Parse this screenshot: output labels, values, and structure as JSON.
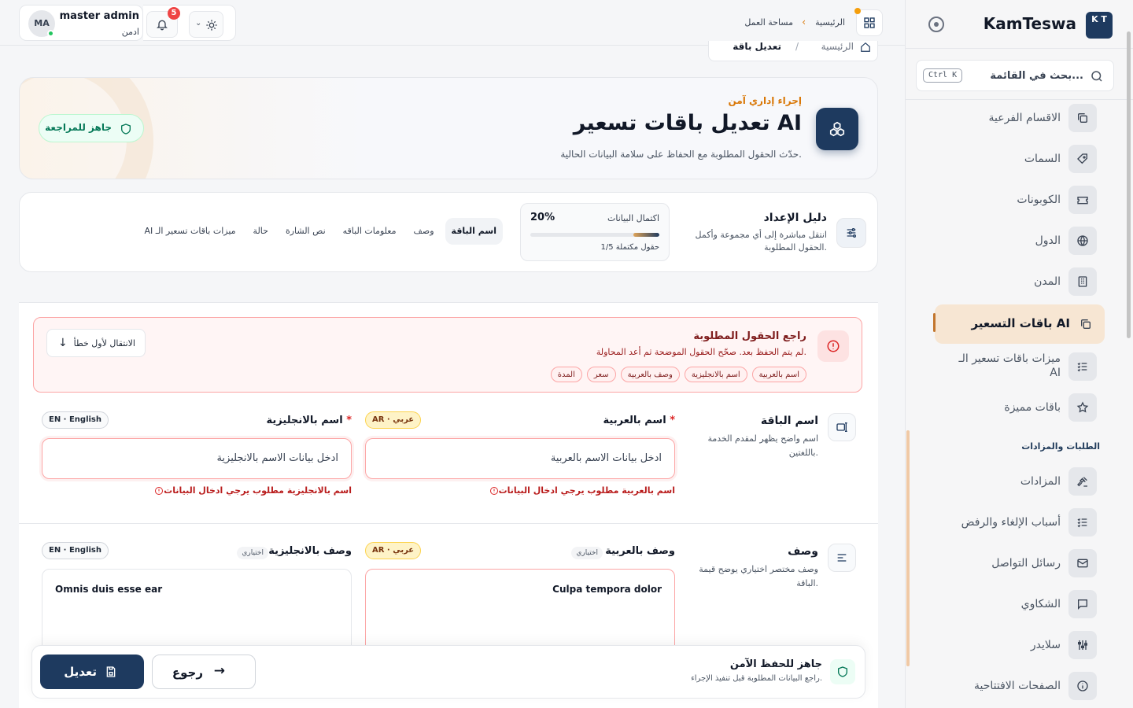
{
  "sidebar": {
    "logo_initials": "K T",
    "brand": "KamTeswa",
    "search_placeholder": "بحث في القائمة...",
    "search_shortcut": "Ctrl K",
    "items": [
      {
        "label": "الاقسام الفرعية",
        "icon": "layers-icon"
      },
      {
        "label": "السمات",
        "icon": "tag-icon"
      },
      {
        "label": "الكوبونات",
        "icon": "ticket-icon"
      },
      {
        "label": "الدول",
        "icon": "globe-icon"
      },
      {
        "label": "المدن",
        "icon": "building-icon"
      },
      {
        "label": "باقات التسعير AI",
        "icon": "copy-icon",
        "active": true
      },
      {
        "label": "ميزات باقات تسعير الـ AI",
        "icon": "list-check-icon"
      },
      {
        "label": "باقات مميزة",
        "icon": "star-icon"
      }
    ],
    "section_title": "الطلبات والمزادات",
    "items2": [
      {
        "label": "المزادات",
        "icon": "gavel-icon"
      },
      {
        "label": "أسباب الإلغاء والرفض",
        "icon": "list-check-icon"
      },
      {
        "label": "رسائل التواصل",
        "icon": "mail-icon"
      },
      {
        "label": "الشكاوي",
        "icon": "message-icon"
      },
      {
        "label": "سلايدر",
        "icon": "sliders-icon"
      },
      {
        "label": "الصفحات الافتتاحية",
        "icon": "info-icon"
      }
    ]
  },
  "topbar": {
    "crumb_home": "الرئيسية",
    "crumb_workspace": "مساحة العمل",
    "user_initials": "MA",
    "user_name": "master admin",
    "user_role": "ادمن",
    "notifications_count": "5"
  },
  "subbreadcrumb": {
    "home": "الرئيسية",
    "sep": "/",
    "current": "تعديل باقة"
  },
  "hero": {
    "kicker": "إجراء إداري آمن",
    "title": "تعديل باقات تسعير AI",
    "subtitle": "حدّث الحقول المطلوبة مع الحفاظ على سلامة البيانات الحالية.",
    "status_pill": "جاهز للمراجعة"
  },
  "guide": {
    "title": "دليل الإعداد",
    "subtitle": "انتقل مباشرة إلى أي مجموعة وأكمل الحقول المطلوبة.",
    "progress_label": "اكتمال البيانات",
    "progress_pct": "20%",
    "progress_value": 0.2,
    "progress_count": "1/5 حقول مكتملة",
    "chips": [
      "اسم الباقة",
      "وصف",
      "معلومات الباقه",
      "نص الشارة",
      "حالة",
      "ميزات باقات تسعير الـ AI"
    ]
  },
  "errors": {
    "title": "راجع الحقول المطلوبة",
    "subtitle": "لم يتم الحفظ بعد. صحّح الحقول الموضحة ثم أعد المحاولة.",
    "tags": [
      "اسم بالعربية",
      "اسم بالانجليزية",
      "وصف بالعربية",
      "سعر",
      "المدة"
    ],
    "jump_button": "الانتقال لأول خطأ"
  },
  "section_name": {
    "title": "اسم الباقة",
    "subtitle": "اسم واضح يظهر لمقدم الخدمة باللغتين.",
    "ar_label": "اسم بالعربية",
    "ar_lang": "AR · عربي",
    "ar_placeholder": "ادخل بيانات الاسم بالعربية",
    "ar_error": "اسم بالعربية مطلوب يرجي ادخال البيانات",
    "en_label": "اسم بالانجليزية",
    "en_lang": "EN · English",
    "en_placeholder": "ادخل بيانات الاسم بالانجليزية",
    "en_error": "اسم بالانجليزية مطلوب يرجي ادخال البيانات",
    "required_mark": "*"
  },
  "section_desc": {
    "title": "وصف",
    "subtitle": "وصف مختصر اختياري يوضح قيمة الباقة.",
    "ar_label": "وصف بالعربية",
    "ar_optional": "اختياري",
    "ar_lang": "AR · عربي",
    "ar_value": "Culpa tempora dolor",
    "en_label": "وصف بالانجليزية",
    "en_optional": "اختياري",
    "en_lang": "EN · English",
    "en_value": "Omnis duis esse ear"
  },
  "footer": {
    "title": "جاهز للحفظ الآمن",
    "subtitle": "راجع البيانات المطلوبة قبل تنفيذ الإجراء.",
    "back_button": "رجوع",
    "save_button": "تعديل"
  }
}
